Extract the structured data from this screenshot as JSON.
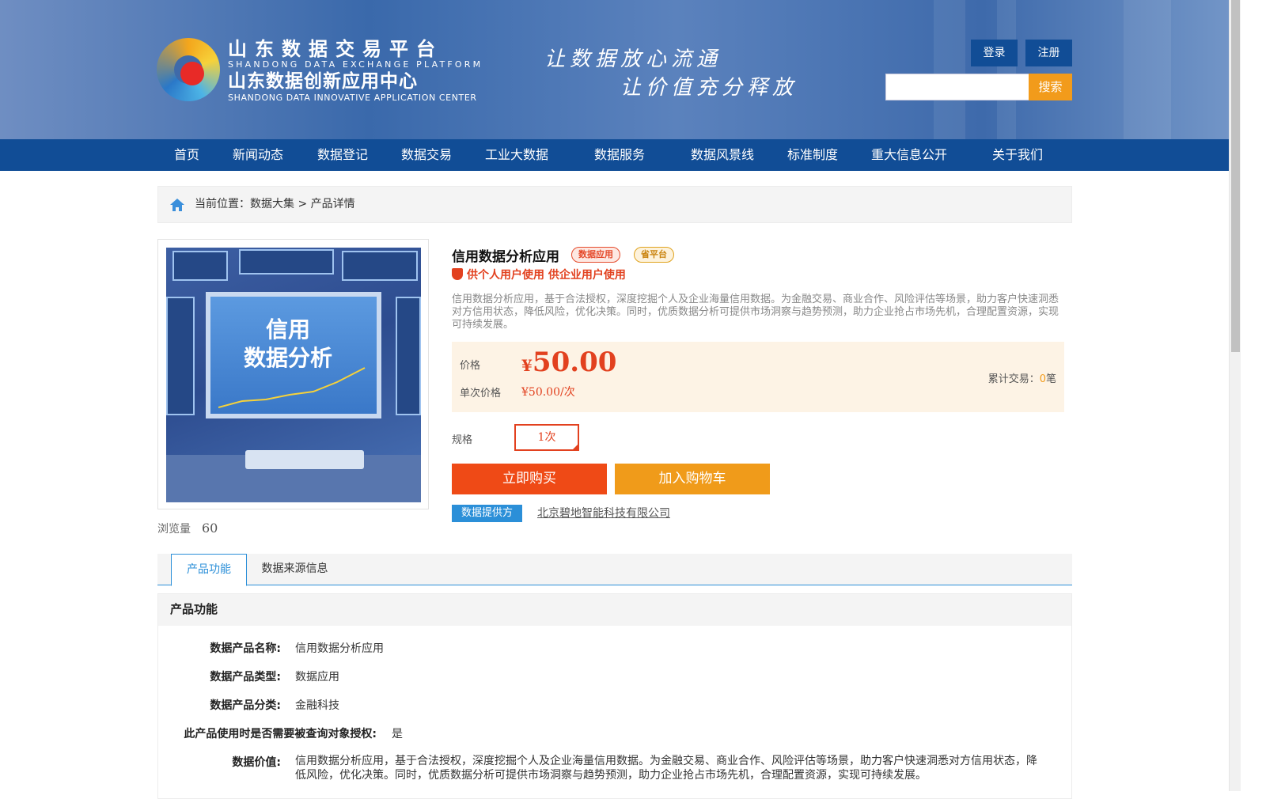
{
  "header": {
    "logo_cn1": "山东数据交易平台",
    "logo_en1": "SHANDONG DATA EXCHANGE PLATFORM",
    "logo_cn2": "山东数据创新应用中心",
    "logo_en2": "SHANDONG DATA INNOVATIVE APPLICATION CENTER",
    "slogan1": "让数据放心流通",
    "slogan2": "让价值充分释放",
    "login_label": "登录",
    "register_label": "注册",
    "search_placeholder": "",
    "search_label": "搜索"
  },
  "nav": {
    "items": [
      {
        "label": "首页"
      },
      {
        "label": "新闻动态"
      },
      {
        "label": "数据登记"
      },
      {
        "label": "数据交易"
      },
      {
        "label": "工业大数据"
      },
      {
        "label": "数据服务"
      },
      {
        "label": "数据风景线"
      },
      {
        "label": "标准制度"
      },
      {
        "label": "重大信息公开"
      },
      {
        "label": "关于我们"
      }
    ]
  },
  "breadcrumb": {
    "text": "当前位置：数据大集 > 产品详情"
  },
  "product": {
    "image_title_line1": "信用",
    "image_title_line2": "数据分析",
    "views_label": "浏览量",
    "views_count": "60",
    "title": "信用数据分析应用",
    "tag1": "数据应用",
    "tag2": "省平台",
    "usage": "供个人用户使用 供企业用户使用",
    "description": "信用数据分析应用，基于合法授权，深度挖掘个人及企业海量信用数据。为金融交易、商业合作、风险评估等场景，助力客户快速洞悉对方信用状态，降低风险，优化决策。同时，优质数据分析可提供市场洞察与趋势预测，助力企业抢占市场先机，合理配置资源，实现可持续发展。",
    "price_label": "价格",
    "price_symbol": "¥",
    "price_value": "50.00",
    "unit_price_label": "单次价格",
    "unit_price_value": "¥50.00/次",
    "trades_label": "累计交易：",
    "trades_count": "0",
    "trades_unit": "笔",
    "spec_label": "规格",
    "spec_option": "1次",
    "buy_label": "立即购买",
    "cart_label": "加入购物车",
    "provider_badge": "数据提供方",
    "provider_name": "北京碧地智能科技有限公司"
  },
  "tabs": {
    "active_label": "产品功能",
    "inactive_label": "数据来源信息"
  },
  "feature": {
    "heading": "产品功能",
    "rows": [
      {
        "key": "数据产品名称:",
        "value": "信用数据分析应用"
      },
      {
        "key": "数据产品类型:",
        "value": "数据应用"
      },
      {
        "key": "数据产品分类:",
        "value": "金融科技"
      },
      {
        "key": "此产品使用时是否需要被查询对象授权:",
        "value": "是"
      },
      {
        "key": "数据价值:",
        "value": "信用数据分析应用，基于合法授权，深度挖掘个人及企业海量信用数据。为金融交易、商业合作、风险评估等场景，助力客户快速洞悉对方信用状态，降低风险，优化决策。同时，优质数据分析可提供市场洞察与趋势预测，助力企业抢占市场先机，合理配置资源，实现可持续发展。"
      }
    ]
  },
  "colors": {
    "nav_blue": "#114d96",
    "accent_red": "#e2411f",
    "accent_orange": "#f09b1a",
    "link_blue": "#2b8fd8"
  }
}
